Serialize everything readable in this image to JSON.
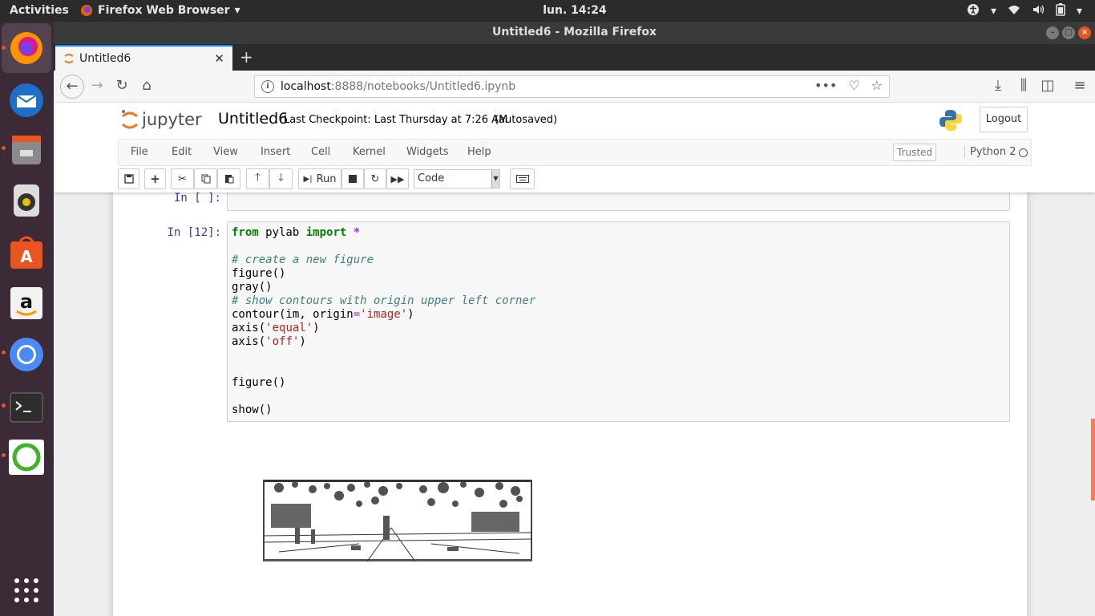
{
  "top_panel": {
    "activities": "Activities",
    "app_menu": "Firefox Web Browser",
    "clock": "lun. 14:24"
  },
  "window": {
    "title": "Untitled6 - Mozilla Firefox"
  },
  "tab": {
    "label": "Untitled6"
  },
  "url": {
    "host": "localhost",
    "rest": ":8888/notebooks/Untitled6.ipynb"
  },
  "jupyter": {
    "logo_text": "jupyter",
    "notebook_name": "Untitled6",
    "checkpoint": "Last Checkpoint: Last Thursday at 7:26 AM",
    "autosave": "(autosaved)",
    "logout": "Logout",
    "menus": [
      "File",
      "Edit",
      "View",
      "Insert",
      "Cell",
      "Kernel",
      "Widgets",
      "Help"
    ],
    "trusted": "Trusted",
    "kernel": "Python 2",
    "run_label": "Run",
    "cell_type": "Code"
  },
  "cells": [
    {
      "prompt": "In [ ]:"
    },
    {
      "prompt": "In [12]:"
    }
  ],
  "colors": {
    "accent": "#e95420",
    "prompt": "#303f9f",
    "dock_bg": "#3c2a36"
  }
}
